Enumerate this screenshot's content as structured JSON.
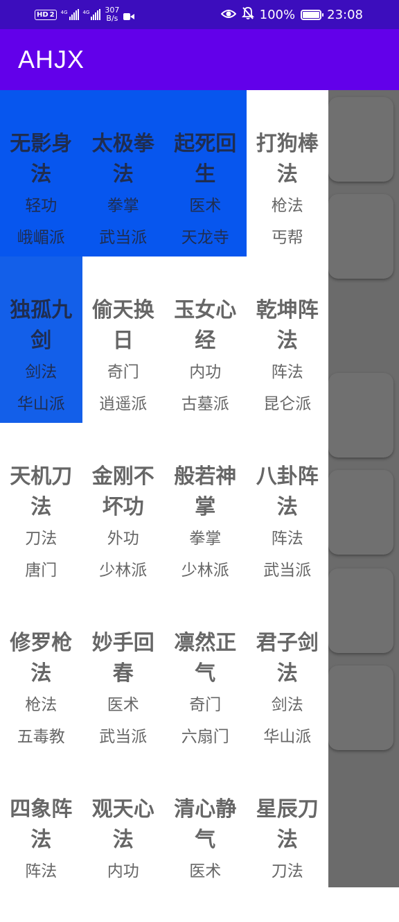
{
  "status_bar": {
    "hd_label": "HD",
    "sim_number": "2",
    "network_1": "4G",
    "network_2": "4G",
    "net_speed_value": "307",
    "net_speed_unit": "B/s",
    "battery_percent": "100%",
    "battery_level": 1.0,
    "time": "23:08"
  },
  "app_bar": {
    "title": "AHJX"
  },
  "colors": {
    "status_bar": "#3c0dbd",
    "app_bar": "#6200ea",
    "selected_cell": "#0756ee",
    "drawer": "#6b6b6b"
  },
  "skills": [
    {
      "name": "无影身法",
      "category": "轻功",
      "sect": "峨嵋派",
      "selected": true
    },
    {
      "name": "太极拳法",
      "category": "拳掌",
      "sect": "武当派",
      "selected": true
    },
    {
      "name": "起死回生",
      "category": "医术",
      "sect": "天龙寺",
      "selected": true
    },
    {
      "name": "打狗棒法",
      "category": "枪法",
      "sect": "丐帮",
      "selected": false
    },
    {
      "name": "独孤九剑",
      "category": "剑法",
      "sect": "华山派",
      "selected": true
    },
    {
      "name": "偷天换日",
      "category": "奇门",
      "sect": "逍遥派",
      "selected": false
    },
    {
      "name": "玉女心经",
      "category": "内功",
      "sect": "古墓派",
      "selected": false
    },
    {
      "name": "乾坤阵法",
      "category": "阵法",
      "sect": "昆仑派",
      "selected": false
    },
    {
      "name": "天机刀法",
      "category": "刀法",
      "sect": "唐门",
      "selected": false
    },
    {
      "name": "金刚不坏功",
      "category": "外功",
      "sect": "少林派",
      "selected": false
    },
    {
      "name": "般若神掌",
      "category": "拳掌",
      "sect": "少林派",
      "selected": false
    },
    {
      "name": "八卦阵法",
      "category": "阵法",
      "sect": "武当派",
      "selected": false
    },
    {
      "name": "修罗枪法",
      "category": "枪法",
      "sect": "五毒教",
      "selected": false
    },
    {
      "name": "妙手回春",
      "category": "医术",
      "sect": "武当派",
      "selected": false
    },
    {
      "name": "凛然正气",
      "category": "奇门",
      "sect": "六扇门",
      "selected": false
    },
    {
      "name": "君子剑法",
      "category": "剑法",
      "sect": "华山派",
      "selected": false
    },
    {
      "name": "四象阵法",
      "category": "阵法",
      "sect": "",
      "selected": false
    },
    {
      "name": "观天心法",
      "category": "内功",
      "sect": "",
      "selected": false
    },
    {
      "name": "清心静气",
      "category": "医术",
      "sect": "",
      "selected": false
    },
    {
      "name": "星辰刀法",
      "category": "刀法",
      "sect": "",
      "selected": false
    }
  ]
}
